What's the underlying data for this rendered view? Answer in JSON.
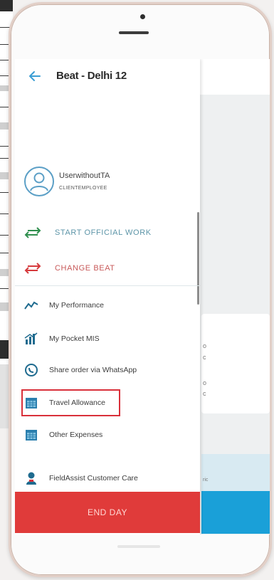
{
  "drawer": {
    "title": "Beat - Delhi 12",
    "user": {
      "name": "UserwithoutTA",
      "role": "CLIENTEMPLOYEE"
    },
    "actions": [
      {
        "label": "START OFFICIAL WORK",
        "icon": "swap-arrows-icon",
        "color": "#5d95a8"
      },
      {
        "label": "CHANGE BEAT",
        "icon": "swap-arrows-red-icon",
        "color": "#c85a5a"
      }
    ],
    "menu": [
      {
        "label": "My Performance",
        "icon": "performance-chart-icon"
      },
      {
        "label": "My Pocket MIS",
        "icon": "bar-chart-icon"
      },
      {
        "label": "Share order via WhatsApp",
        "icon": "whatsapp-icon"
      },
      {
        "label": "Travel Allowance",
        "icon": "calendar-icon",
        "highlighted": true
      },
      {
        "label": "Other Expenses",
        "icon": "calendar-icon"
      },
      {
        "label": "FieldAssist Customer Care",
        "icon": "customer-care-icon"
      }
    ],
    "end_day_label": "END DAY"
  },
  "background_app": {
    "fragments": [
      "o",
      "c",
      "o",
      "c",
      "ric"
    ]
  },
  "colors": {
    "accent_teal": "#5d95a8",
    "accent_red": "#c85a5a",
    "end_day_bg": "#e03b3a",
    "highlight_border": "#d9303a",
    "blue_bar": "#1aa0d8"
  }
}
